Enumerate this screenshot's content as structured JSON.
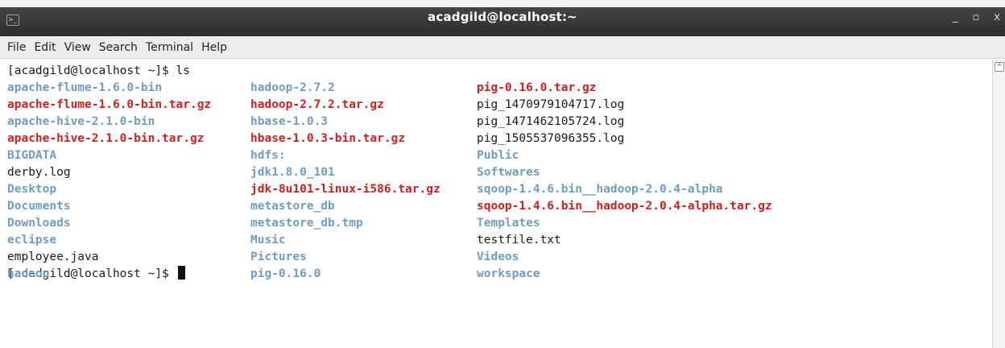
{
  "window": {
    "title": "acadgild@localhost:~",
    "terminal_icon": "terminal-icon",
    "minimize": "_",
    "maximize": "▫",
    "close": "x"
  },
  "menu": [
    "File",
    "Edit",
    "View",
    "Search",
    "Terminal",
    "Help"
  ],
  "terminal": {
    "prompt1": "[acadgild@localhost ~]$ ls",
    "prompt2": "[acadgild@localhost ~]$ ",
    "columns": [
      [
        {
          "name": "apache-flume-1.6.0-bin",
          "kind": "dir"
        },
        {
          "name": "apache-flume-1.6.0-bin.tar.gz",
          "kind": "arc"
        },
        {
          "name": "apache-hive-2.1.0-bin",
          "kind": "dir"
        },
        {
          "name": "apache-hive-2.1.0-bin.tar.gz",
          "kind": "arc"
        },
        {
          "name": "BIGDATA",
          "kind": "dir"
        },
        {
          "name": "derby.log",
          "kind": "file"
        },
        {
          "name": "Desktop",
          "kind": "dir"
        },
        {
          "name": "Documents",
          "kind": "dir"
        },
        {
          "name": "Downloads",
          "kind": "dir"
        },
        {
          "name": "eclipse",
          "kind": "dir"
        },
        {
          "name": "employee.java",
          "kind": "file"
        },
        {
          "name": "hadoop",
          "kind": "dir"
        }
      ],
      [
        {
          "name": "hadoop-2.7.2",
          "kind": "dir"
        },
        {
          "name": "hadoop-2.7.2.tar.gz",
          "kind": "arc"
        },
        {
          "name": "hbase-1.0.3",
          "kind": "dir"
        },
        {
          "name": "hbase-1.0.3-bin.tar.gz",
          "kind": "arc"
        },
        {
          "name": "hdfs:",
          "kind": "dir"
        },
        {
          "name": "jdk1.8.0_101",
          "kind": "dir"
        },
        {
          "name": "jdk-8u101-linux-i586.tar.gz",
          "kind": "arc"
        },
        {
          "name": "metastore_db",
          "kind": "dir"
        },
        {
          "name": "metastore_db.tmp",
          "kind": "dir"
        },
        {
          "name": "Music",
          "kind": "dir"
        },
        {
          "name": "Pictures",
          "kind": "dir"
        },
        {
          "name": "pig-0.16.0",
          "kind": "dir"
        }
      ],
      [
        {
          "name": "pig-0.16.0.tar.gz",
          "kind": "arc"
        },
        {
          "name": "pig_1470979104717.log",
          "kind": "file"
        },
        {
          "name": "pig_1471462105724.log",
          "kind": "file"
        },
        {
          "name": "pig_1505537096355.log",
          "kind": "file"
        },
        {
          "name": "Public",
          "kind": "dir"
        },
        {
          "name": "Softwares",
          "kind": "dir"
        },
        {
          "name": "sqoop-1.4.6.bin__hadoop-2.0.4-alpha",
          "kind": "dir"
        },
        {
          "name": "sqoop-1.4.6.bin__hadoop-2.0.4-alpha.tar.gz",
          "kind": "arc"
        },
        {
          "name": "Templates",
          "kind": "dir"
        },
        {
          "name": "testfile.txt",
          "kind": "file"
        },
        {
          "name": "Videos",
          "kind": "dir"
        },
        {
          "name": "workspace",
          "kind": "dir"
        }
      ]
    ]
  },
  "colors": {
    "dir": "#6f9bc6",
    "arc": "#d11f1f",
    "file": "#1a1a1a"
  }
}
